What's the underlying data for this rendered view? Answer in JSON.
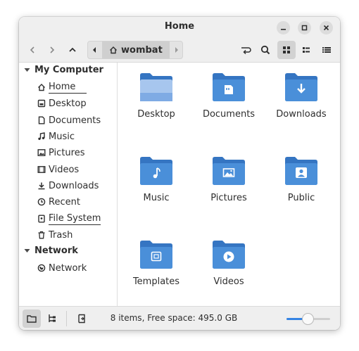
{
  "window": {
    "title": "Home"
  },
  "titlebar_buttons": [
    "minimize-icon",
    "maximize-icon",
    "close-icon"
  ],
  "pathbar": {
    "current": "wombat"
  },
  "sidebar": {
    "my_computer_label": "My Computer",
    "network_label": "Network",
    "items": [
      {
        "label": "Home",
        "icon": "home-icon",
        "selected": true
      },
      {
        "label": "Desktop",
        "icon": "desktop-icon"
      },
      {
        "label": "Documents",
        "icon": "document-icon"
      },
      {
        "label": "Music",
        "icon": "music-icon"
      },
      {
        "label": "Pictures",
        "icon": "picture-icon"
      },
      {
        "label": "Videos",
        "icon": "video-icon"
      },
      {
        "label": "Downloads",
        "icon": "download-icon"
      },
      {
        "label": "Recent",
        "icon": "recent-icon"
      },
      {
        "label": "File System",
        "icon": "drive-icon",
        "underlined": true
      },
      {
        "label": "Trash",
        "icon": "trash-icon"
      }
    ],
    "network_items": [
      {
        "label": "Network",
        "icon": "network-icon"
      }
    ]
  },
  "files": [
    {
      "label": "Desktop",
      "icon": "desktop-folder-icon"
    },
    {
      "label": "Documents",
      "icon": "documents-folder-icon"
    },
    {
      "label": "Downloads",
      "icon": "downloads-folder-icon"
    },
    {
      "label": "Music",
      "icon": "music-folder-icon"
    },
    {
      "label": "Pictures",
      "icon": "pictures-folder-icon"
    },
    {
      "label": "Public",
      "icon": "public-folder-icon"
    },
    {
      "label": "Templates",
      "icon": "templates-folder-icon"
    },
    {
      "label": "Videos",
      "icon": "videos-folder-icon"
    }
  ],
  "statusbar": {
    "text": "8 items, Free space: 495.0 GB",
    "zoom_fraction": 0.5
  },
  "colors": {
    "folder": "#4a8fd9",
    "folder_dark": "#3575c2",
    "accent": "#3584e4"
  }
}
